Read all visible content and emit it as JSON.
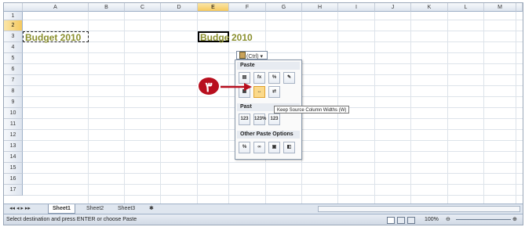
{
  "columns": [
    "A",
    "B",
    "C",
    "D",
    "E",
    "F",
    "G",
    "H",
    "I",
    "J",
    "K",
    "L",
    "M"
  ],
  "rows": [
    "1",
    "2",
    "3",
    "4",
    "5",
    "6",
    "7",
    "8",
    "9",
    "10",
    "11",
    "12",
    "13",
    "14",
    "15",
    "16",
    "17"
  ],
  "cells": {
    "a2": "Budget 2010",
    "e2_part1": "Budge",
    "e2_part2": "2010"
  },
  "paste_options_button": "(Ctrl) ▾",
  "paste_menu": {
    "paste_header": "Paste",
    "paste_values_header": "Past",
    "other_header": "Other Paste Options",
    "paste_icons": [
      "paste",
      "fx",
      "%fx",
      "no-borders",
      "keep-widths",
      "transpose"
    ],
    "values_icons": [
      "123",
      "123%",
      "123"
    ],
    "other_icons": [
      "%",
      "link",
      "picture",
      "linked-picture"
    ]
  },
  "tooltip": "Keep Source Column Widths (W)",
  "step_badge": "٣",
  "sheet_tabs": [
    "Sheet1",
    "Sheet2",
    "Sheet3"
  ],
  "status_text": "Select destination and press ENTER or choose Paste",
  "zoom": "100%",
  "colors": {
    "accent_badge": "#b80f1e",
    "budget_text": "#8a8f2e",
    "selected_header": "#f5c95e"
  }
}
